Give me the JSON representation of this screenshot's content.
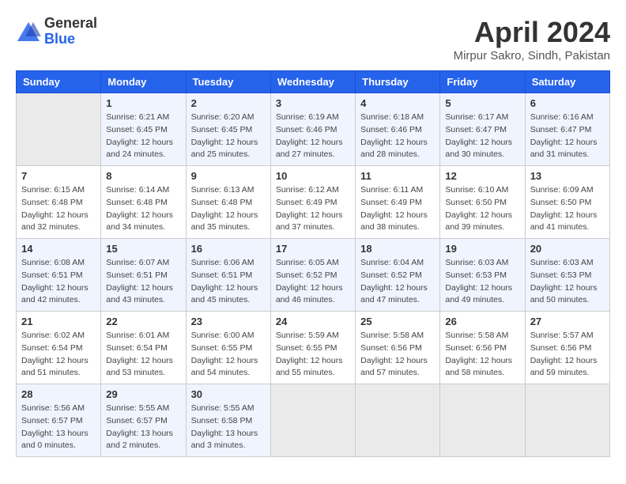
{
  "header": {
    "logo_general": "General",
    "logo_blue": "Blue",
    "month": "April 2024",
    "location": "Mirpur Sakro, Sindh, Pakistan"
  },
  "days_of_week": [
    "Sunday",
    "Monday",
    "Tuesday",
    "Wednesday",
    "Thursday",
    "Friday",
    "Saturday"
  ],
  "weeks": [
    [
      {
        "day": "",
        "info": ""
      },
      {
        "day": "1",
        "info": "Sunrise: 6:21 AM\nSunset: 6:45 PM\nDaylight: 12 hours\nand 24 minutes."
      },
      {
        "day": "2",
        "info": "Sunrise: 6:20 AM\nSunset: 6:45 PM\nDaylight: 12 hours\nand 25 minutes."
      },
      {
        "day": "3",
        "info": "Sunrise: 6:19 AM\nSunset: 6:46 PM\nDaylight: 12 hours\nand 27 minutes."
      },
      {
        "day": "4",
        "info": "Sunrise: 6:18 AM\nSunset: 6:46 PM\nDaylight: 12 hours\nand 28 minutes."
      },
      {
        "day": "5",
        "info": "Sunrise: 6:17 AM\nSunset: 6:47 PM\nDaylight: 12 hours\nand 30 minutes."
      },
      {
        "day": "6",
        "info": "Sunrise: 6:16 AM\nSunset: 6:47 PM\nDaylight: 12 hours\nand 31 minutes."
      }
    ],
    [
      {
        "day": "7",
        "info": "Sunrise: 6:15 AM\nSunset: 6:48 PM\nDaylight: 12 hours\nand 32 minutes."
      },
      {
        "day": "8",
        "info": "Sunrise: 6:14 AM\nSunset: 6:48 PM\nDaylight: 12 hours\nand 34 minutes."
      },
      {
        "day": "9",
        "info": "Sunrise: 6:13 AM\nSunset: 6:48 PM\nDaylight: 12 hours\nand 35 minutes."
      },
      {
        "day": "10",
        "info": "Sunrise: 6:12 AM\nSunset: 6:49 PM\nDaylight: 12 hours\nand 37 minutes."
      },
      {
        "day": "11",
        "info": "Sunrise: 6:11 AM\nSunset: 6:49 PM\nDaylight: 12 hours\nand 38 minutes."
      },
      {
        "day": "12",
        "info": "Sunrise: 6:10 AM\nSunset: 6:50 PM\nDaylight: 12 hours\nand 39 minutes."
      },
      {
        "day": "13",
        "info": "Sunrise: 6:09 AM\nSunset: 6:50 PM\nDaylight: 12 hours\nand 41 minutes."
      }
    ],
    [
      {
        "day": "14",
        "info": "Sunrise: 6:08 AM\nSunset: 6:51 PM\nDaylight: 12 hours\nand 42 minutes."
      },
      {
        "day": "15",
        "info": "Sunrise: 6:07 AM\nSunset: 6:51 PM\nDaylight: 12 hours\nand 43 minutes."
      },
      {
        "day": "16",
        "info": "Sunrise: 6:06 AM\nSunset: 6:51 PM\nDaylight: 12 hours\nand 45 minutes."
      },
      {
        "day": "17",
        "info": "Sunrise: 6:05 AM\nSunset: 6:52 PM\nDaylight: 12 hours\nand 46 minutes."
      },
      {
        "day": "18",
        "info": "Sunrise: 6:04 AM\nSunset: 6:52 PM\nDaylight: 12 hours\nand 47 minutes."
      },
      {
        "day": "19",
        "info": "Sunrise: 6:03 AM\nSunset: 6:53 PM\nDaylight: 12 hours\nand 49 minutes."
      },
      {
        "day": "20",
        "info": "Sunrise: 6:03 AM\nSunset: 6:53 PM\nDaylight: 12 hours\nand 50 minutes."
      }
    ],
    [
      {
        "day": "21",
        "info": "Sunrise: 6:02 AM\nSunset: 6:54 PM\nDaylight: 12 hours\nand 51 minutes."
      },
      {
        "day": "22",
        "info": "Sunrise: 6:01 AM\nSunset: 6:54 PM\nDaylight: 12 hours\nand 53 minutes."
      },
      {
        "day": "23",
        "info": "Sunrise: 6:00 AM\nSunset: 6:55 PM\nDaylight: 12 hours\nand 54 minutes."
      },
      {
        "day": "24",
        "info": "Sunrise: 5:59 AM\nSunset: 6:55 PM\nDaylight: 12 hours\nand 55 minutes."
      },
      {
        "day": "25",
        "info": "Sunrise: 5:58 AM\nSunset: 6:56 PM\nDaylight: 12 hours\nand 57 minutes."
      },
      {
        "day": "26",
        "info": "Sunrise: 5:58 AM\nSunset: 6:56 PM\nDaylight: 12 hours\nand 58 minutes."
      },
      {
        "day": "27",
        "info": "Sunrise: 5:57 AM\nSunset: 6:56 PM\nDaylight: 12 hours\nand 59 minutes."
      }
    ],
    [
      {
        "day": "28",
        "info": "Sunrise: 5:56 AM\nSunset: 6:57 PM\nDaylight: 13 hours\nand 0 minutes."
      },
      {
        "day": "29",
        "info": "Sunrise: 5:55 AM\nSunset: 6:57 PM\nDaylight: 13 hours\nand 2 minutes."
      },
      {
        "day": "30",
        "info": "Sunrise: 5:55 AM\nSunset: 6:58 PM\nDaylight: 13 hours\nand 3 minutes."
      },
      {
        "day": "",
        "info": ""
      },
      {
        "day": "",
        "info": ""
      },
      {
        "day": "",
        "info": ""
      },
      {
        "day": "",
        "info": ""
      }
    ]
  ]
}
